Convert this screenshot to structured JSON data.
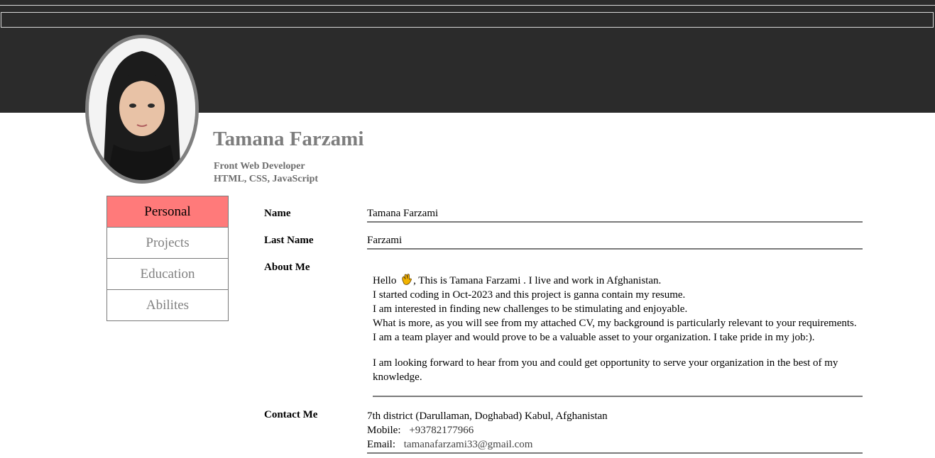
{
  "profile": {
    "name": "Tamana Farzami",
    "role": "Front Web Developer",
    "skills": "HTML, CSS, JavaScript"
  },
  "tabs": [
    {
      "label": "Personal",
      "active": true
    },
    {
      "label": "Projects",
      "active": false
    },
    {
      "label": "Education",
      "active": false
    },
    {
      "label": "Abilites",
      "active": false
    }
  ],
  "personal": {
    "name_label": "Name",
    "name_value": "Tamana Farzami",
    "lastname_label": "Last Name",
    "lastname_value": "Farzami",
    "about_label": "About Me",
    "about_lines": [
      "Hello",
      ", This is Tamana Farzami . I live and work in Afghanistan.",
      "I started coding in Oct-2023 and this project is ganna contain my resume.",
      "I am interested in finding new challenges to be stimulating and enjoyable.",
      "What is more, as you will see from my attached CV, my background is particularly relevant to your requirements.",
      "I am a team player and would prove to be a valuable asset to your organization. I take pride in my job:)."
    ],
    "about_closing": "I am looking forward to hear from you and could get opportunity to serve your organization in the best of my knowledge.",
    "contact_label": "Contact Me",
    "address": "7th district (Darullaman, Doghabad) Kabul, Afghanistan",
    "mobile_label": "Mobile:",
    "mobile_value": "+93782177966",
    "email_label": "Email:",
    "email_value": "tamanafarzami33@gmail.com"
  },
  "colors": {
    "header": "#2b2b2b",
    "active_tab": "#ff7a7a",
    "name_text": "#7d7d7d"
  },
  "icons": {
    "wave": "waving-hand-icon"
  }
}
